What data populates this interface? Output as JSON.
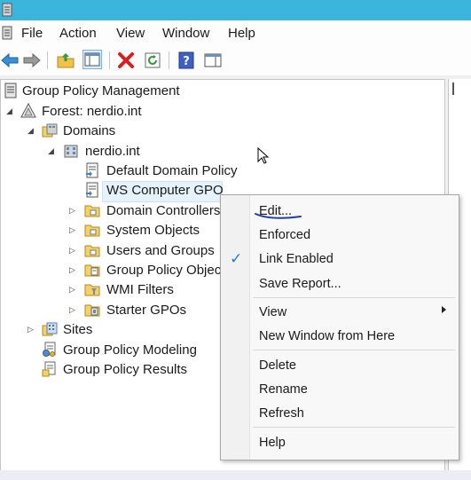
{
  "menubar": {
    "items": [
      "File",
      "Action",
      "View",
      "Window",
      "Help"
    ]
  },
  "toolbar": {
    "buttons": [
      "back-icon",
      "forward-icon",
      "up-folder-icon",
      "show-hide-tree-icon",
      "delete-icon",
      "refresh-icon",
      "help-icon",
      "show-hide-action-pane-icon"
    ]
  },
  "tree": {
    "root": "Group Policy Management",
    "forest": "Forest: nerdio.int",
    "domains": "Domains",
    "domain": "nerdio.int",
    "children": [
      "Default Domain Policy",
      "WS Computer GPO",
      "Domain Controllers",
      "System Objects",
      "Users and Groups",
      "Group Policy Objec",
      "WMI Filters",
      "Starter GPOs"
    ],
    "sites": "Sites",
    "modeling": "Group Policy Modeling",
    "results": "Group Policy Results",
    "selected": "WS Computer GPO"
  },
  "context_menu": {
    "items": [
      "Edit...",
      "Enforced",
      "Link Enabled",
      "Save Report...",
      "View",
      "New Window from Here",
      "Delete",
      "Rename",
      "Refresh",
      "Help"
    ],
    "checked": "Link Enabled",
    "submenu": "View"
  },
  "colors": {
    "titlebar": "#3cb5dc",
    "selection": "#e5f1fb",
    "underline_annotation": "#1e3fa0"
  }
}
